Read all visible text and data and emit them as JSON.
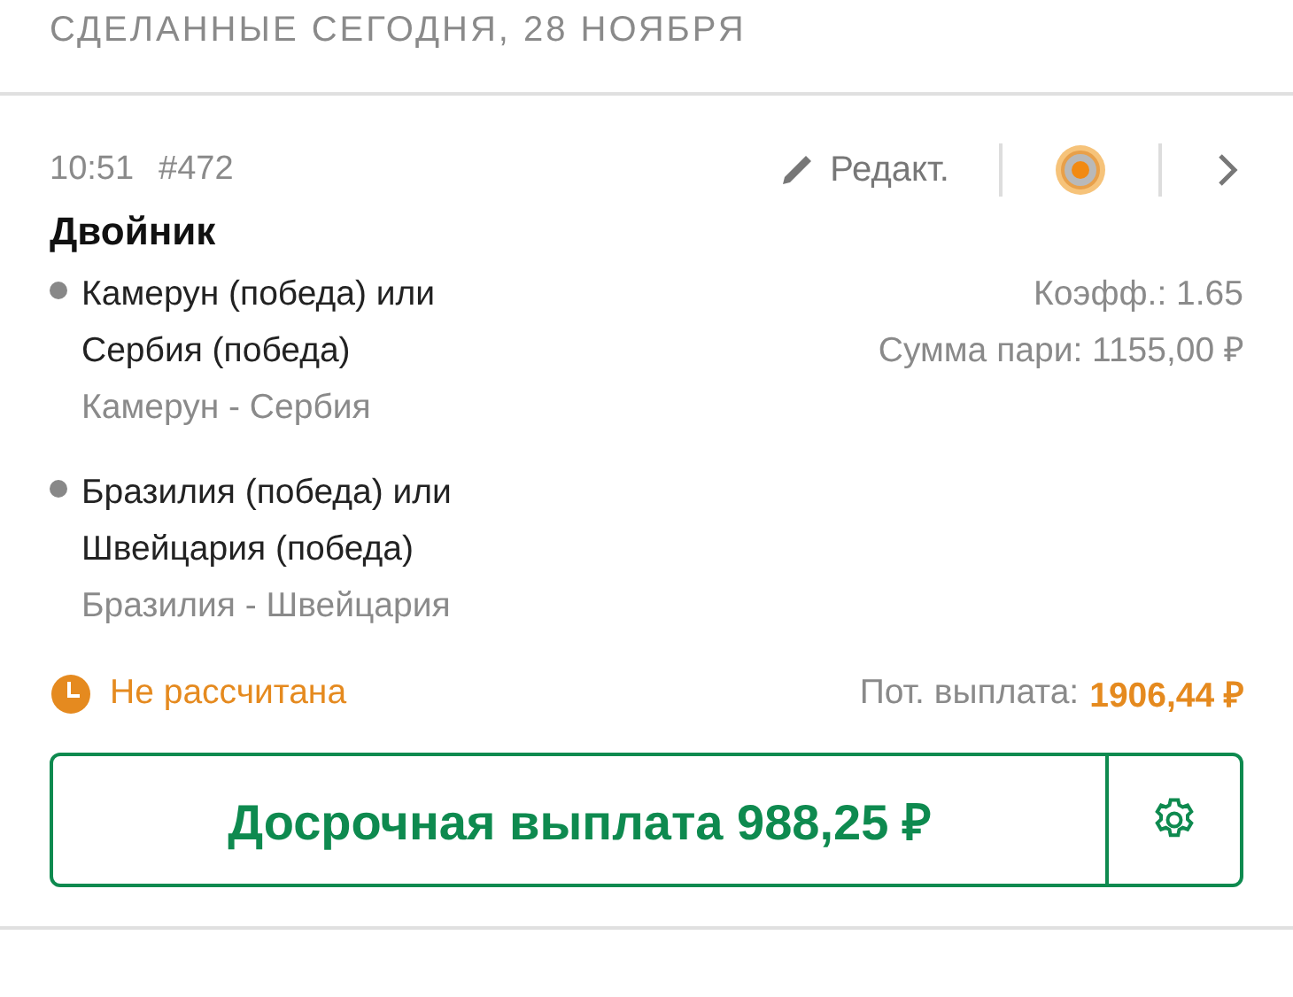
{
  "section_title": "СДЕЛАННЫЕ СЕГОДНЯ, 28 НОЯБРЯ",
  "bet": {
    "time": "10:51",
    "number": "#472",
    "edit_label": "Редакт.",
    "type": "Двойник",
    "selections": [
      {
        "pick": "Камерун (победа) или Сербия (победа)",
        "match": "Камерун - Сербия"
      },
      {
        "pick": "Бразилия (победа) или Швейцария (победа)",
        "match": "Бразилия - Швейцария"
      }
    ],
    "odds": "Коэфф.: 1.65",
    "stake": "Сумма пари: 1155,00 ₽",
    "status": {
      "kind": "pending",
      "label": "Не рассчитана"
    },
    "payout_label": "Пот. выплата:",
    "payout_value": "1906,44 ₽",
    "cashout_label": "Досрочная выплата 988,25 ₽"
  }
}
